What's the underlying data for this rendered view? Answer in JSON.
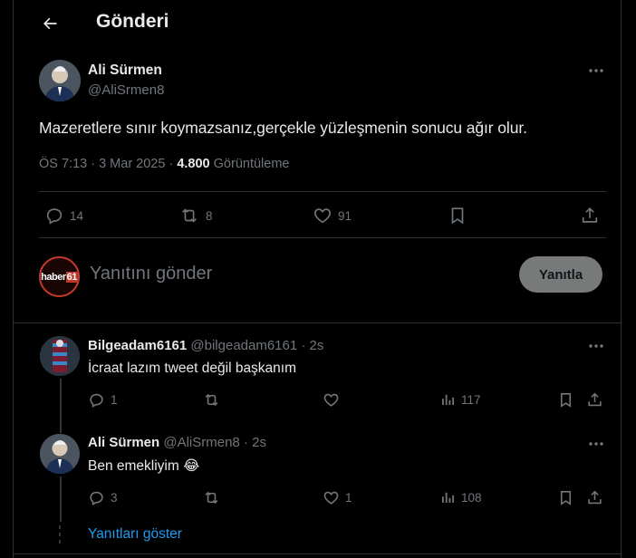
{
  "header": {
    "title": "Gönderi"
  },
  "tweet": {
    "name": "Ali Sürmen",
    "handle": "@AliSrmen8",
    "text": "Mazeretlere sınır koymazsanız,gerçekle yüzleşmenin sonucu ağır olur.",
    "time": "ÖS 7:13 · 3 Mar 2025 · ",
    "views": "4.800",
    "views_label": " Görüntüleme",
    "replies": "14",
    "reposts": "8",
    "likes": "91"
  },
  "composer": {
    "avatar_text_a": "haber",
    "avatar_text_b": "61",
    "placeholder": "Yanıtını gönder",
    "button": "Yanıtla"
  },
  "replies": [
    {
      "name": "Bilgeadam6161",
      "handle": " @bilgeadam6161 · 2s",
      "text": "İcraat lazım  tweet değil başkanım",
      "replies": "1",
      "reposts": "",
      "likes": "",
      "views": "117"
    },
    {
      "name": "Ali Sürmen",
      "handle": " @AliSrmen8 · 2s",
      "text": "Ben emekliyim 😂",
      "replies": "3",
      "reposts": "",
      "likes": "1",
      "views": "108"
    }
  ],
  "show_replies": "Yanıtları göster",
  "colors": {
    "background": "#000000",
    "text": "#e7e9ea",
    "muted": "#71767b",
    "accent": "#1d9bf0",
    "border": "#2f3336"
  }
}
